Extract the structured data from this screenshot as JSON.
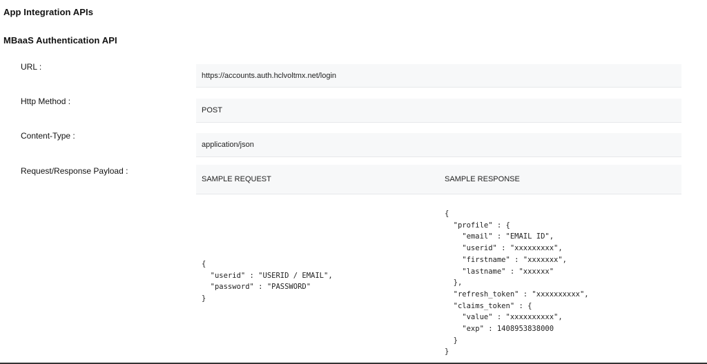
{
  "page": {
    "heading": "App Integration APIs",
    "subheading": "MBaaS Authentication API"
  },
  "fields": {
    "url": {
      "label": "URL :",
      "value": "https://accounts.auth.hclvoltmx.net/login"
    },
    "method": {
      "label": "Http Method :",
      "value": "POST"
    },
    "content_type": {
      "label": "Content-Type :",
      "value": "application/json"
    },
    "payload": {
      "label": "Request/Response Payload :"
    }
  },
  "payload": {
    "request_header": "SAMPLE REQUEST",
    "response_header": "SAMPLE RESPONSE",
    "request_body": "{\n  \"userid\" : \"USERID / EMAIL\",\n  \"password\" : \"PASSWORD\"\n}",
    "response_body": "{\n  \"profile\" : {\n    \"email\" : \"EMAIL ID\",\n    \"userid\" : \"xxxxxxxxx\",\n    \"firstname\" : \"xxxxxxx\",\n    \"lastname\" : \"xxxxxx\"\n  },\n  \"refresh_token\" : \"xxxxxxxxxx\",\n  \"claims_token\" : {\n    \"value\" : \"xxxxxxxxxx\",\n    \"exp\" : 1408953838000\n  }\n}"
  }
}
